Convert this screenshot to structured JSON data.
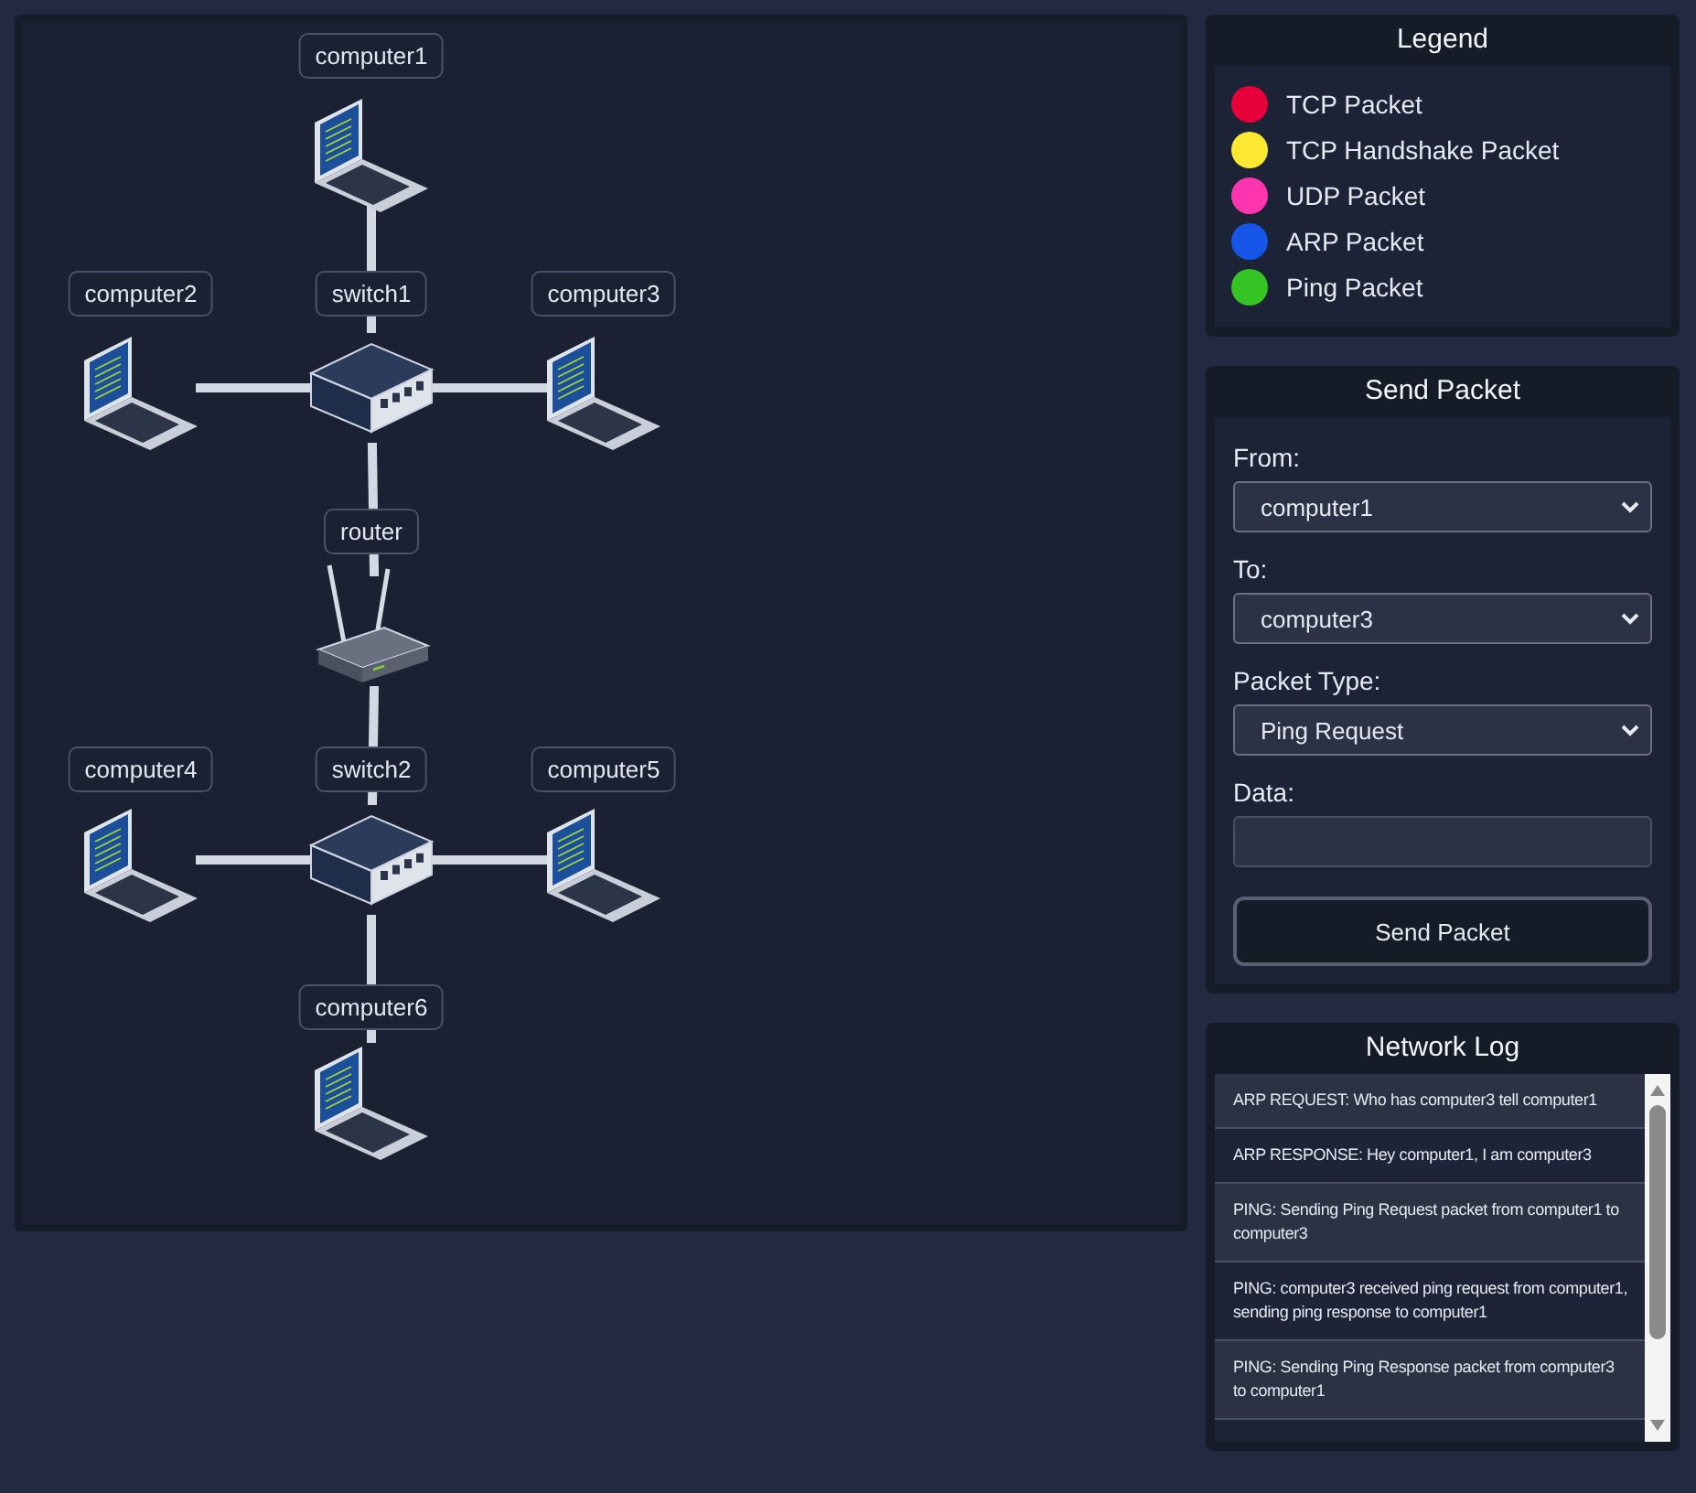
{
  "network": {
    "nodes": [
      {
        "label": "router",
        "kind": "router",
        "children": [
          {
            "label": "switch1",
            "kind": "switch",
            "children": [
              {
                "label": "computer1",
                "kind": "laptop"
              },
              {
                "label": "computer2",
                "kind": "laptop"
              },
              {
                "label": "computer3",
                "kind": "laptop"
              }
            ]
          },
          {
            "label": "switch2",
            "kind": "switch",
            "children": [
              {
                "label": "computer4",
                "kind": "laptop"
              },
              {
                "label": "computer5",
                "kind": "laptop"
              },
              {
                "label": "computer6",
                "kind": "laptop"
              }
            ]
          }
        ]
      }
    ]
  },
  "legend": {
    "title": "Legend",
    "items": [
      {
        "label": "TCP Packet",
        "color": "#e8003a"
      },
      {
        "label": "TCP Handshake Packet",
        "color": "#ffe830"
      },
      {
        "label": "UDP Packet",
        "color": "#ff35b0"
      },
      {
        "label": "ARP Packet",
        "color": "#1556e8"
      },
      {
        "label": "Ping Packet",
        "color": "#35c424"
      }
    ]
  },
  "send_packet": {
    "title": "Send Packet",
    "fields": [
      {
        "label": "From:",
        "kind": "select",
        "value": "computer1"
      },
      {
        "label": "To:",
        "kind": "select",
        "value": "computer3"
      },
      {
        "label": "Packet Type:",
        "kind": "select",
        "value": "Ping Request"
      },
      {
        "label": "Data:",
        "kind": "text"
      }
    ],
    "button": "Send Packet"
  },
  "network_log": {
    "title": "Network Log",
    "entries": [
      "ARP REQUEST: Who has computer3 tell computer1",
      "ARP RESPONSE: Hey computer1, I am computer3",
      "PING: Sending Ping Request packet from computer1 to computer3",
      "PING: computer3 received ping request from computer1, sending ping response to computer1",
      "PING: Sending Ping Response packet from computer3 to computer1"
    ]
  }
}
